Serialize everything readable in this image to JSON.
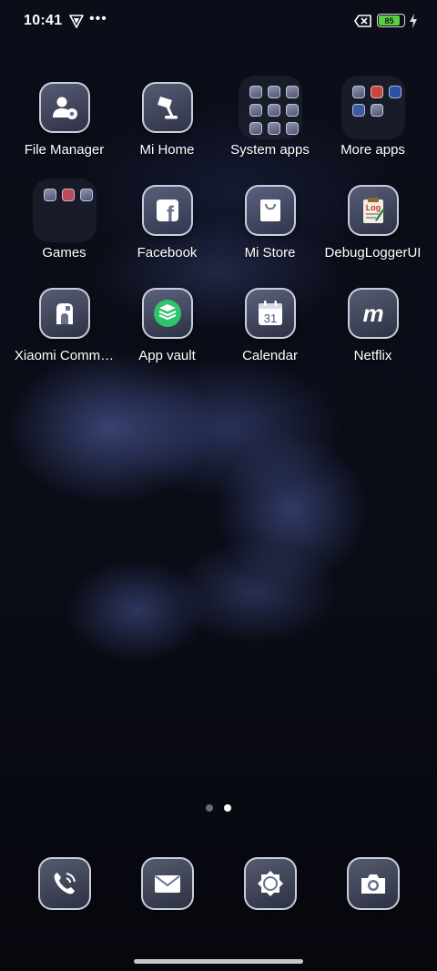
{
  "status_bar": {
    "time": "10:41",
    "battery_percent": "85",
    "battery_color": "#59d13a",
    "icons": [
      "vpn-icon",
      "more-dots-icon",
      "no-sim-icon",
      "battery-icon",
      "charging-icon"
    ]
  },
  "apps": [
    {
      "label": "File Manager",
      "icon": "file-manager-icon"
    },
    {
      "label": "Mi Home",
      "icon": "mi-home-lamp-icon"
    },
    {
      "label": "System apps",
      "icon": "folder-icon"
    },
    {
      "label": "More apps",
      "icon": "folder-icon"
    },
    {
      "label": "Games",
      "icon": "folder-icon"
    },
    {
      "label": "Facebook",
      "icon": "facebook-icon"
    },
    {
      "label": "Mi Store",
      "icon": "shopping-bag-icon"
    },
    {
      "label": "DebugLoggerUI",
      "icon": "log-clipboard-icon"
    },
    {
      "label": "Xiaomi Comm…",
      "icon": "xiaomi-community-icon"
    },
    {
      "label": "App vault",
      "icon": "app-vault-icon"
    },
    {
      "label": "Calendar",
      "icon": "calendar-icon",
      "day": "31"
    },
    {
      "label": "Netflix",
      "icon": "netflix-m-icon",
      "glyph": "m"
    }
  ],
  "facebook_glyph": "f",
  "log_glyph": "Log",
  "pages": {
    "count": 2,
    "active": 2
  },
  "dock": [
    {
      "name": "phone",
      "icon": "phone-icon"
    },
    {
      "name": "messages",
      "icon": "message-icon"
    },
    {
      "name": "browser",
      "icon": "browser-icon"
    },
    {
      "name": "camera",
      "icon": "camera-icon"
    }
  ]
}
